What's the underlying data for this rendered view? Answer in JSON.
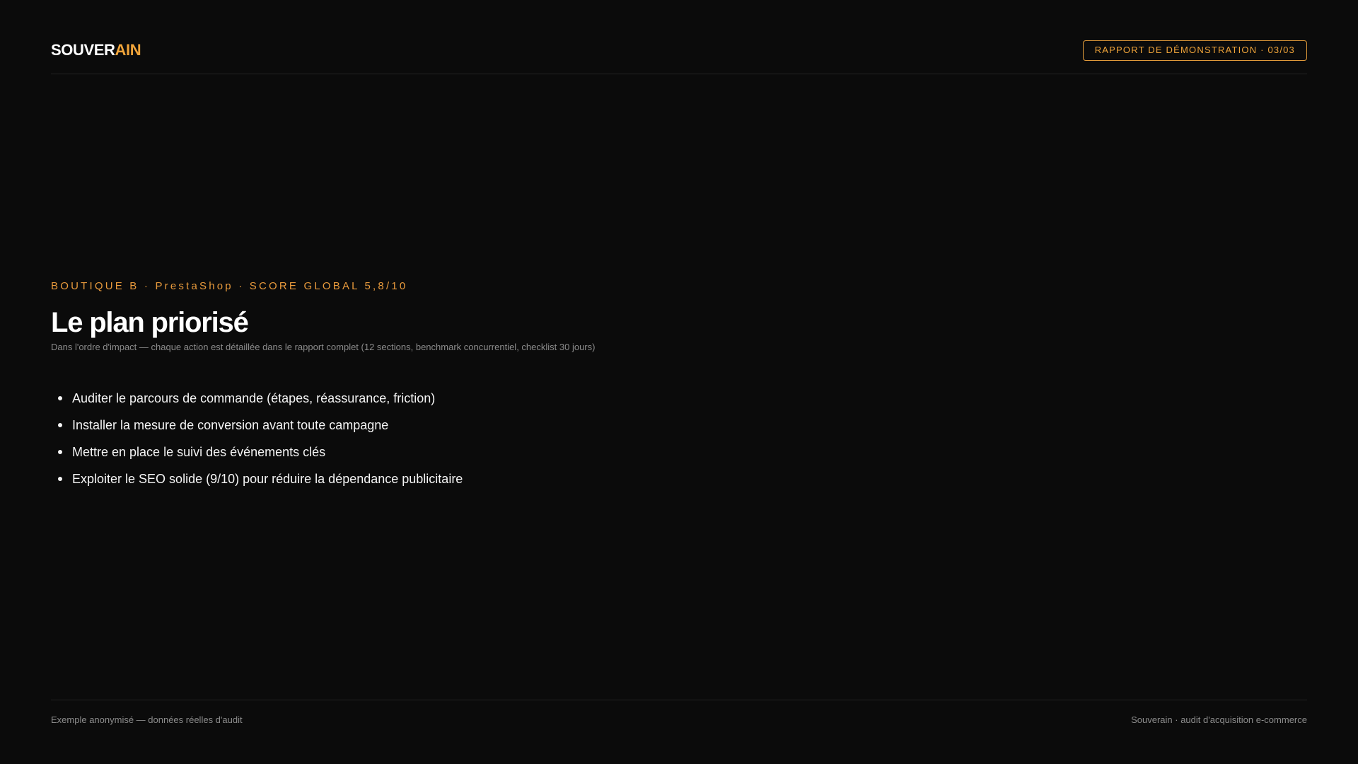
{
  "header": {
    "logo_primary": "SOUVER",
    "logo_accent": "AIN",
    "badge": "RAPPORT DE DÉMONSTRATION · 03/03"
  },
  "main": {
    "eyebrow": "BOUTIQUE B · PrestaShop · SCORE GLOBAL 5,8/10",
    "title": "Le plan priorisé",
    "subtitle": "Dans l'ordre d'impact — chaque action est détaillée dans le rapport complet (12 sections, benchmark concurrentiel, checklist 30 jours)",
    "actions": [
      "Auditer le parcours de commande (étapes, réassurance, friction)",
      "Installer la mesure de conversion avant toute campagne",
      "Mettre en place le suivi des événements clés",
      "Exploiter le SEO solide (9/10) pour réduire la dépendance publicitaire"
    ]
  },
  "footer": {
    "left": "Exemple anonymisé — données réelles d'audit",
    "right": "Souverain · audit d'acquisition e-commerce"
  },
  "colors": {
    "background": "#0b0b0b",
    "accent": "#f0a43a",
    "text": "#ffffff",
    "muted": "#8c8c8c"
  }
}
